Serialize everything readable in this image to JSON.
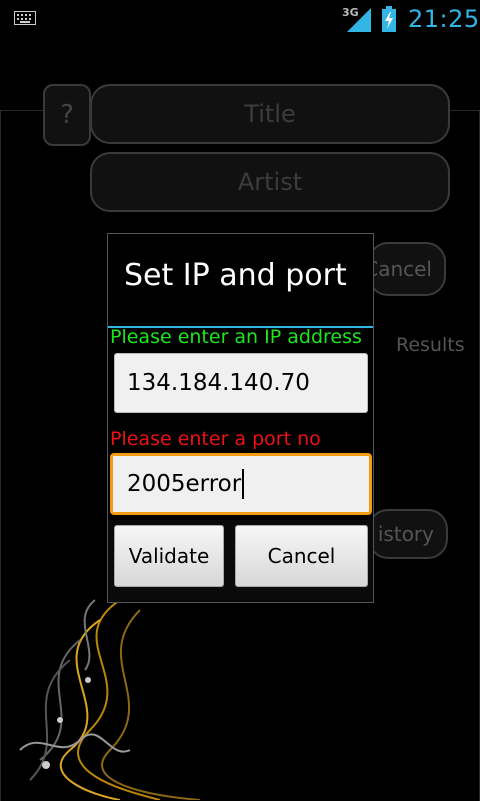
{
  "status_bar": {
    "network": "3G",
    "time": "21:25"
  },
  "background": {
    "help_label": "?",
    "title_placeholder": "Title",
    "artist_placeholder": "Artist",
    "cancel_label": "Cancel",
    "results_label": "Results",
    "history_label": "istory"
  },
  "dialog": {
    "title": "Set IP and port",
    "ip_label": "Please enter an IP address",
    "ip_value": "134.184.140.70",
    "port_label": "Please enter a port no",
    "port_value": "2005error",
    "validate_label": "Validate",
    "cancel_label": "Cancel"
  },
  "colors": {
    "accent": "#33b5e5",
    "ip_label": "#1ee61e",
    "port_label": "#e11111",
    "focus": "#f39c12"
  }
}
